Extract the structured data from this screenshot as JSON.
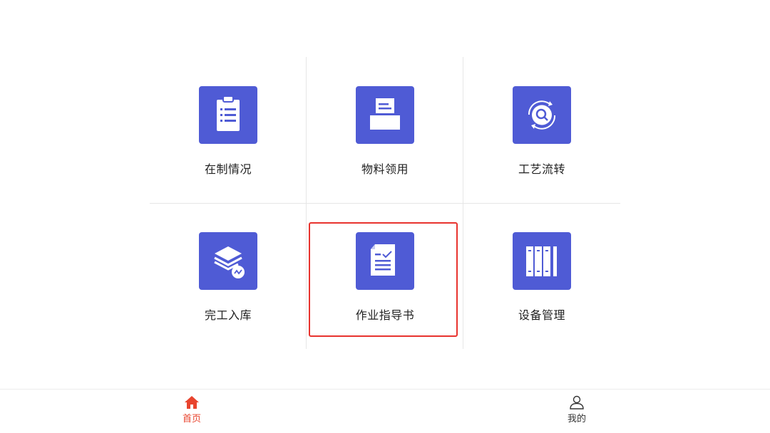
{
  "grid": {
    "items": [
      {
        "label": "在制情况",
        "icon": "clipboard-list-icon"
      },
      {
        "label": "物料领用",
        "icon": "printer-tray-icon"
      },
      {
        "label": "工艺流转",
        "icon": "rotate-search-icon"
      },
      {
        "label": "完工入库",
        "icon": "layers-stack-icon"
      },
      {
        "label": "作业指导书",
        "icon": "document-check-icon"
      },
      {
        "label": "设备管理",
        "icon": "binders-icon"
      }
    ],
    "selected_index": 4
  },
  "tabbar": {
    "items": [
      {
        "label": "首页",
        "icon": "home-icon",
        "active": true
      },
      {
        "label": "我的",
        "icon": "user-icon",
        "active": false
      }
    ]
  },
  "colors": {
    "tile_background": "#4f5bd5",
    "active_tab": "#e8442e",
    "inactive_tab": "#333333",
    "highlight_border": "#e8332e"
  }
}
